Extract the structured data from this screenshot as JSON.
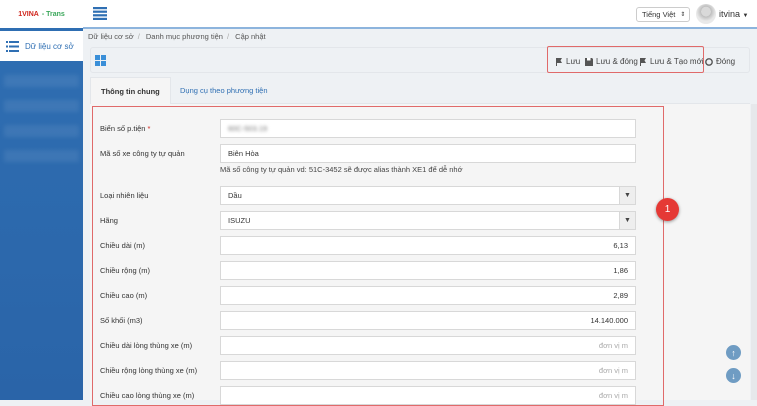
{
  "logo": {
    "brand": "1VINA",
    "suffix": "- Trans"
  },
  "sidebar": {
    "items": [
      {
        "label": "Dữ liệu cơ sở"
      }
    ]
  },
  "header": {
    "language": "Tiếng Việt",
    "user": "itvina"
  },
  "breadcrumb": [
    "Dữ liệu cơ sở",
    "Danh mục phương tiện",
    "Cập nhật"
  ],
  "toolbar": {
    "save": "Lưu",
    "save_close": "Lưu & đóng",
    "save_new": "Lưu & Tạo mới",
    "close": "Đóng"
  },
  "tabs": [
    "Thông tin chung",
    "Dụng cụ theo phương tiện"
  ],
  "form": {
    "plate": {
      "label": "Biển số p.tiện",
      "required": "*",
      "value": "60C-503.19"
    },
    "alias": {
      "label": "Mã số xe công ty tự quản",
      "value": "Biên Hòa",
      "help": "Mã số công ty tự quản vd: 51C-3452 sẽ được alias thành XE1 để dễ nhớ"
    },
    "fuel": {
      "label": "Loại nhiên liệu",
      "value": "Dầu"
    },
    "brand": {
      "label": "Hãng",
      "value": "ISUZU"
    },
    "length": {
      "label": "Chiều dài (m)",
      "value": "6,13"
    },
    "width": {
      "label": "Chiều rộng (m)",
      "value": "1,86"
    },
    "height": {
      "label": "Chiều cao (m)",
      "value": "2,89"
    },
    "volume": {
      "label": "Số khối (m3)",
      "value": "14.140.000"
    },
    "inner_length": {
      "label": "Chiều dài lòng thùng xe (m)",
      "placeholder": "đơn vị m"
    },
    "inner_width": {
      "label": "Chiều rộng lòng thùng xe (m)",
      "placeholder": "đơn vị m"
    },
    "inner_height": {
      "label": "Chiều cao lòng thùng xe (m)",
      "placeholder": "đơn vị m"
    }
  },
  "annotation": {
    "badge": "1"
  }
}
